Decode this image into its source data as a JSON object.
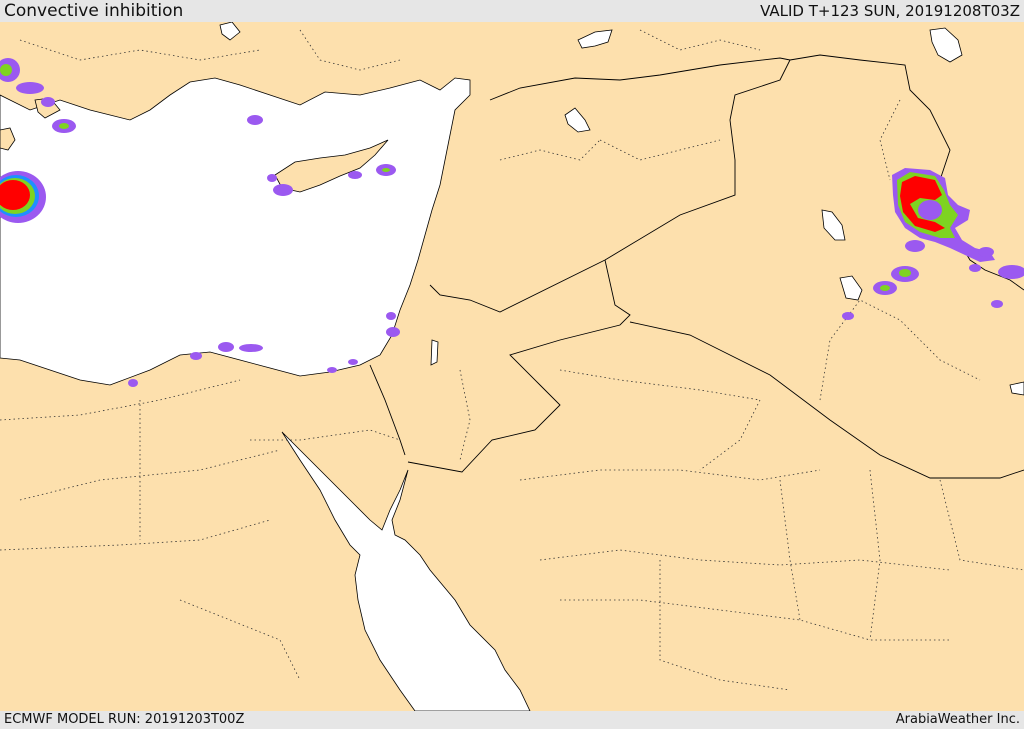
{
  "header": {
    "title": "Convective inhibition",
    "valid": "VALID T+123 SUN, 20191208T03Z"
  },
  "footer": {
    "model_run": "ECMWF MODEL RUN: 20191203T00Z",
    "brand": "ArabiaWeather Inc."
  },
  "colors": {
    "land": "#fde0ad",
    "water": "#ffffff",
    "border": "#000000",
    "cin_low": "#9b59f0",
    "cin_mid": "#1e90ff",
    "cin_green": "#7ed321",
    "cin_high": "#ff0000"
  }
}
